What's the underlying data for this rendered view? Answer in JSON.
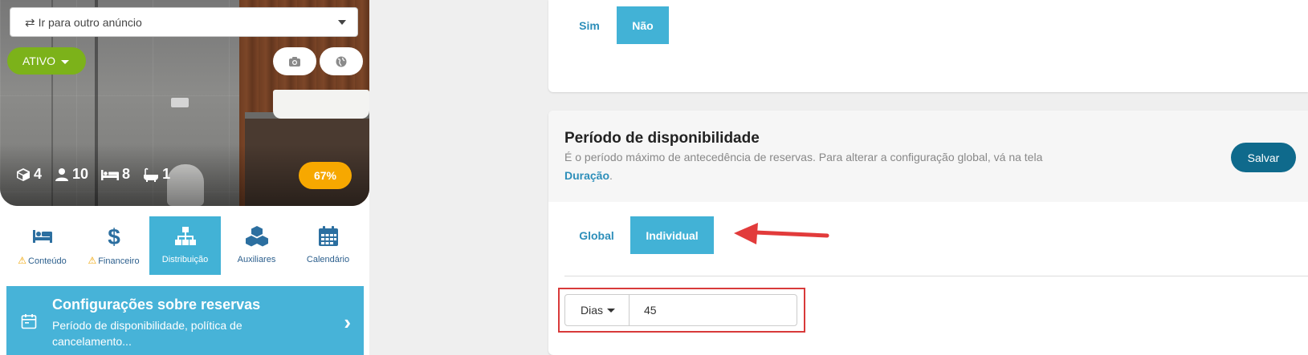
{
  "listing_nav": {
    "label": "Ir para outro anúncio",
    "icon": "swap-icon"
  },
  "status": {
    "label": "ATIVO"
  },
  "hero_buttons": {
    "camera_icon": "camera-icon",
    "globe_icon": "globe-icon"
  },
  "stats": [
    {
      "icon": "cube-icon",
      "value": "4"
    },
    {
      "icon": "user-icon",
      "value": "10"
    },
    {
      "icon": "bed-icon",
      "value": "8"
    },
    {
      "icon": "bathtub-icon",
      "value": "1"
    }
  ],
  "completion": "67%",
  "tabs": [
    {
      "label": "Conteúdo",
      "icon": "bed-icon",
      "warning": true
    },
    {
      "label": "Financeiro",
      "icon": "dollar-icon",
      "warning": true
    },
    {
      "label": "Distribuição",
      "icon": "sitemap-icon",
      "active": true
    },
    {
      "label": "Auxiliares",
      "icon": "boxes-icon"
    },
    {
      "label": "Calendário",
      "icon": "calendar-icon"
    }
  ],
  "config_item": {
    "title": "Configurações sobre reservas",
    "subtitle": "Período de disponibilidade, política de cancelamento..."
  },
  "toggle_top": {
    "yes": "Sim",
    "no": "Não",
    "selected": "Não"
  },
  "availability": {
    "title": "Período de disponibilidade",
    "description": "É o período máximo de antecedência de reservas. Para alterar a configuração global, vá na tela ",
    "link": "Duração",
    "description_end": ".",
    "save_label": "Salvar",
    "mode_global": "Global",
    "mode_individual": "Individual",
    "selected_mode": "Individual",
    "unit": "Dias",
    "value": "45"
  },
  "colors": {
    "accent": "#42b2d6",
    "link": "#2e8fba",
    "status_green": "#7cb21a",
    "percent_orange": "#f7a800",
    "save_blue": "#0f6a8c",
    "annotation_red": "#d83a3a"
  }
}
